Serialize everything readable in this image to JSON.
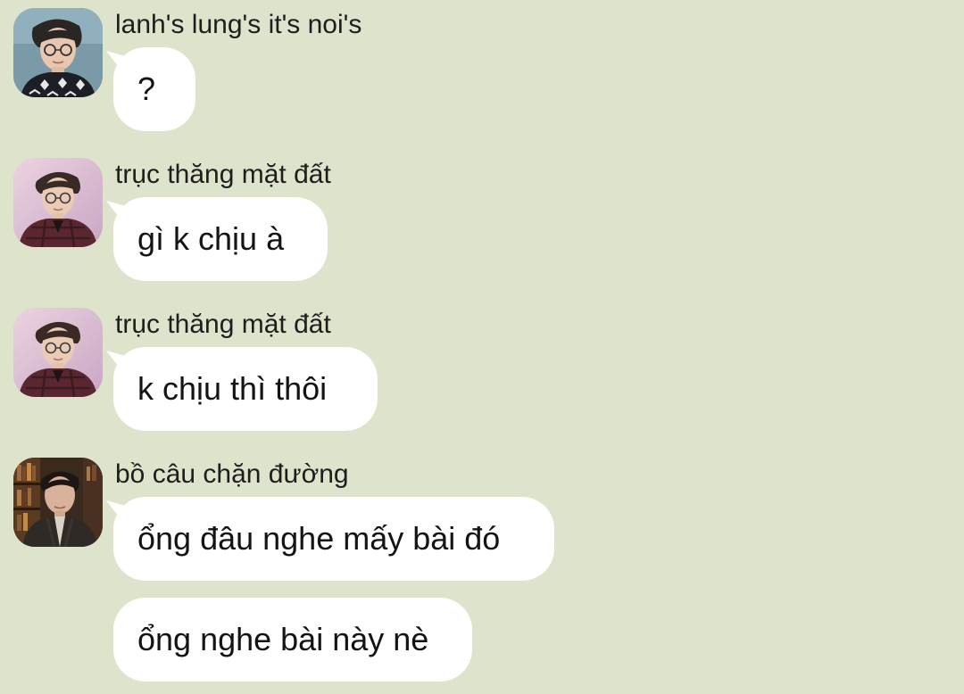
{
  "conversation": {
    "messages": [
      {
        "sender": "lanh's lung's it's noi's",
        "avatar": "avatar-user-glasses-patterned-sweater",
        "bubbles": [
          "?"
        ]
      },
      {
        "sender": "trục thăng mặt đất",
        "avatar": "avatar-user-glasses-pink-background",
        "bubbles": [
          "gì k chịu à"
        ]
      },
      {
        "sender": "trục thăng mặt đất",
        "avatar": "avatar-user-glasses-pink-background",
        "bubbles": [
          "k chịu thì thôi"
        ]
      },
      {
        "sender": "bồ câu chặn đường",
        "avatar": "avatar-user-bookshelf-background",
        "bubbles": [
          "ổng đâu nghe mấy bài đó",
          "ổng nghe bài này nè"
        ]
      }
    ]
  },
  "colors": {
    "background": "#dee4cc",
    "bubble": "#ffffff",
    "text": "#141414"
  }
}
